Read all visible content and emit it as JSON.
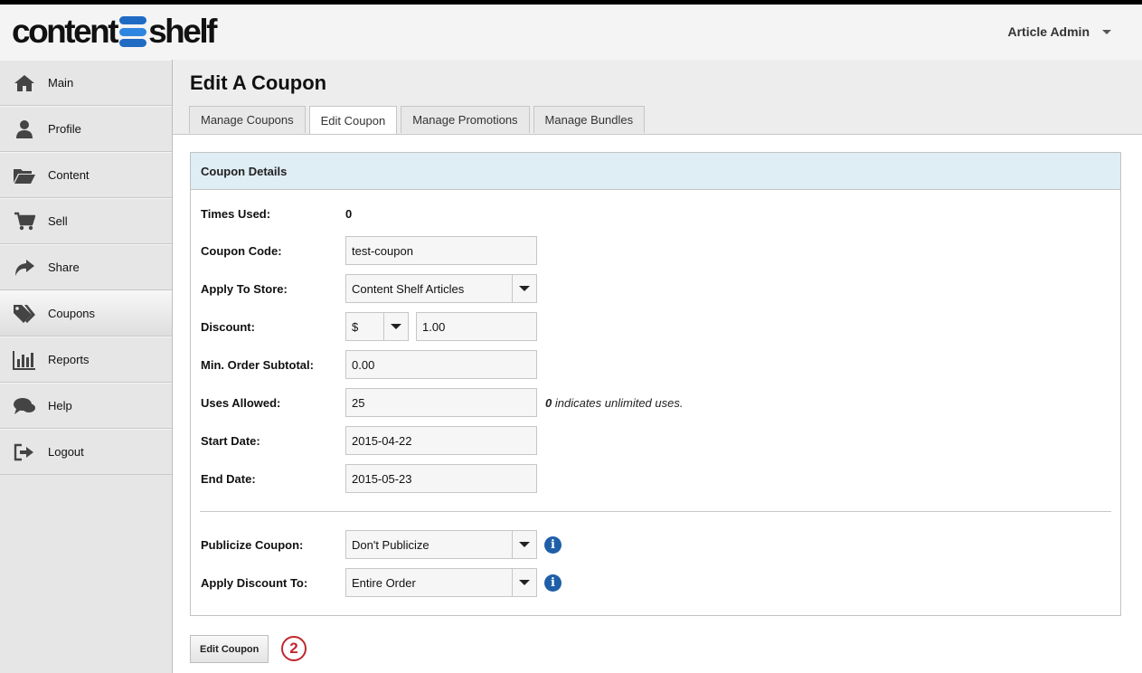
{
  "app": {
    "logo_left": "content",
    "logo_right": "shelf",
    "user_name": "Article Admin"
  },
  "sidebar": {
    "items": [
      {
        "label": "Main",
        "icon": "home-icon"
      },
      {
        "label": "Profile",
        "icon": "user-icon"
      },
      {
        "label": "Content",
        "icon": "folder-icon"
      },
      {
        "label": "Sell",
        "icon": "cart-icon"
      },
      {
        "label": "Share",
        "icon": "share-icon"
      },
      {
        "label": "Coupons",
        "icon": "tags-icon",
        "active": true
      },
      {
        "label": "Reports",
        "icon": "bar-chart-icon"
      },
      {
        "label": "Help",
        "icon": "chat-icon"
      },
      {
        "label": "Logout",
        "icon": "logout-icon"
      }
    ]
  },
  "page": {
    "title": "Edit A Coupon",
    "tabs": [
      {
        "label": "Manage Coupons",
        "active": false
      },
      {
        "label": "Edit Coupon",
        "active": true
      },
      {
        "label": "Manage Promotions",
        "active": false
      },
      {
        "label": "Manage Bundles",
        "active": false
      }
    ]
  },
  "form": {
    "panel_title": "Coupon Details",
    "times_used": {
      "label": "Times Used:",
      "value": "0"
    },
    "coupon_code": {
      "label": "Coupon Code:",
      "value": "test-coupon"
    },
    "apply_to_store": {
      "label": "Apply To Store:",
      "value": "Content Shelf Articles"
    },
    "discount": {
      "label": "Discount:",
      "type": "$",
      "value": "1.00"
    },
    "min_order": {
      "label": "Min. Order Subtotal:",
      "value": "0.00"
    },
    "uses_allowed": {
      "label": "Uses Allowed:",
      "value": "25",
      "hint_bold": "0",
      "hint_text": " indicates unlimited uses."
    },
    "start_date": {
      "label": "Start Date:",
      "value": "2015-04-22"
    },
    "end_date": {
      "label": "End Date:",
      "value": "2015-05-23"
    },
    "publicize": {
      "label": "Publicize Coupon:",
      "value": "Don't Publicize"
    },
    "apply_discount_to": {
      "label": "Apply Discount To:",
      "value": "Entire Order"
    }
  },
  "actions": {
    "submit_label": "Edit Coupon",
    "step_number": "2"
  },
  "colors": {
    "panel_header": "#dfedf4",
    "info_icon": "#1f5fa8",
    "step_marker": "#c0282d",
    "logo_mark": "#1f6bc4"
  }
}
